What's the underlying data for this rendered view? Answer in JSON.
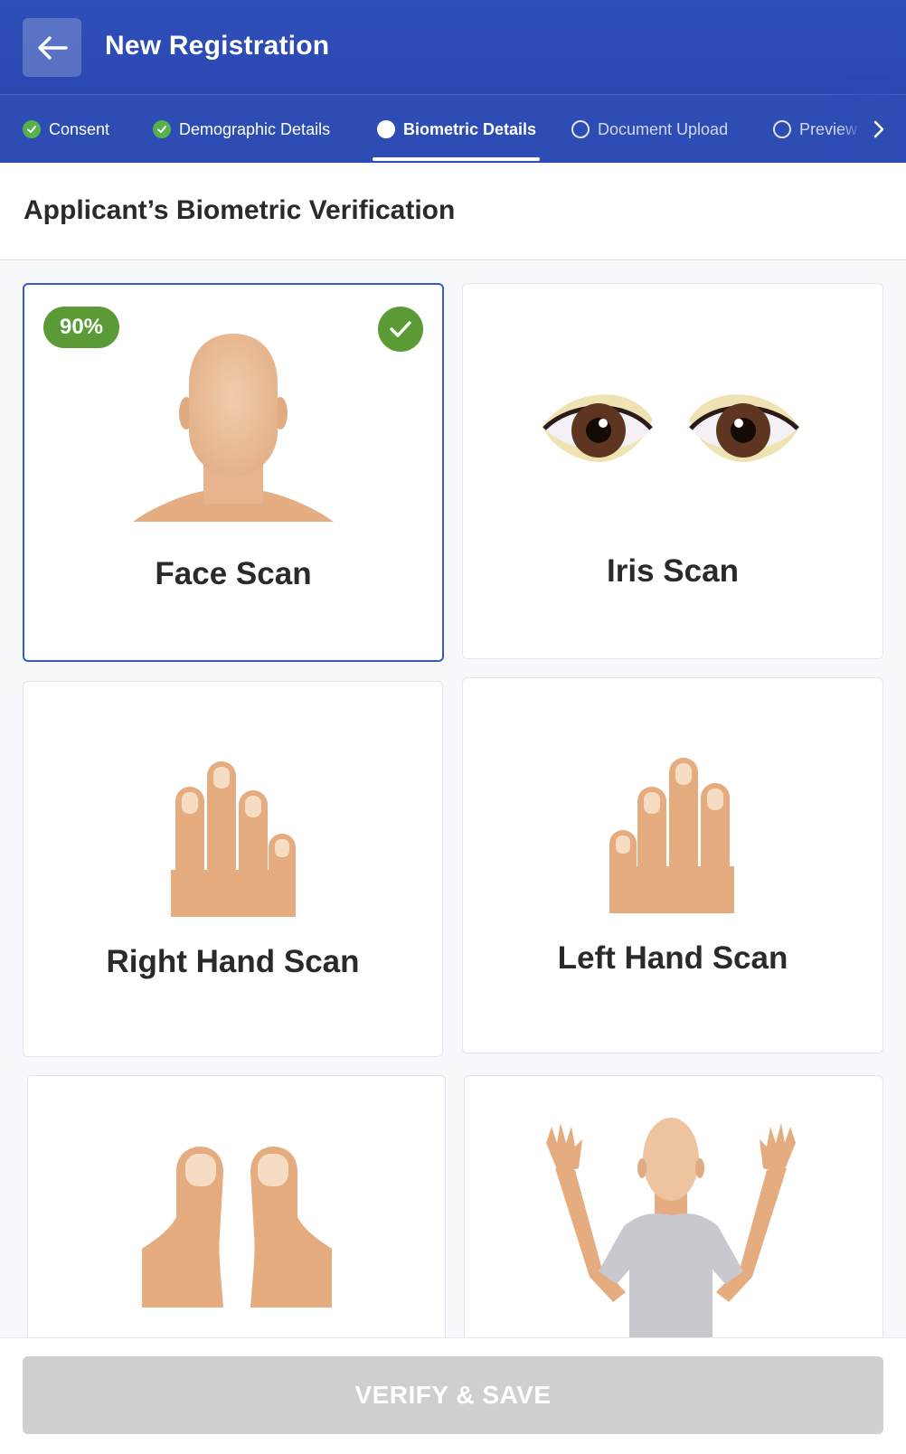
{
  "header": {
    "title": "New Registration",
    "back_icon": "arrow-left-icon",
    "background": "#2f4fb8"
  },
  "stepper": {
    "steps": [
      {
        "label": "Consent",
        "state": "done"
      },
      {
        "label": "Demographic Details",
        "state": "done"
      },
      {
        "label": "Biometric Details",
        "state": "active"
      },
      {
        "label": "Document Upload",
        "state": "todo"
      },
      {
        "label": "Preview",
        "state": "todo"
      }
    ],
    "next_icon": "chevron-right-icon"
  },
  "section": {
    "title": "Applicant’s Biometric Verification"
  },
  "cards": [
    {
      "label": "Face Scan",
      "selected": true,
      "score": "90%",
      "completed": true
    },
    {
      "label": "Iris Scan",
      "selected": false
    },
    {
      "label": "Right Hand Scan",
      "selected": false
    },
    {
      "label": "Left Hand Scan",
      "selected": false
    },
    {
      "label": "",
      "selected": false
    },
    {
      "label": "",
      "selected": false
    }
  ],
  "footer": {
    "verify_label": "VERIFY & SAVE",
    "verify_enabled": false
  },
  "colors": {
    "primary": "#2f4fb8",
    "success": "#5a9b36",
    "step_done": "#57b14a",
    "disabled_button": "#cfcfcf",
    "skin": "#e4aa7c"
  }
}
